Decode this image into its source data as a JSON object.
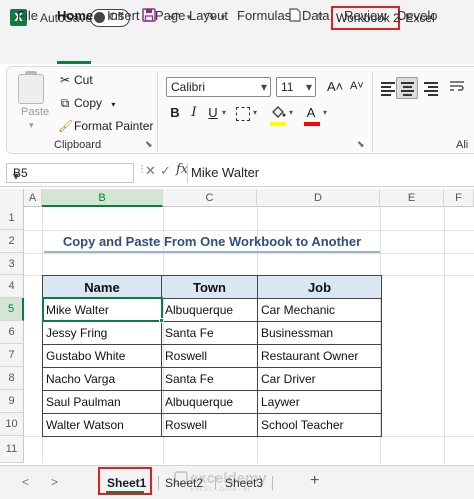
{
  "titlebar": {
    "app_logo": "X",
    "autosave_label": "AutoSave",
    "autosave_state": "Off",
    "document_title": "Workbook 2",
    "app_name": "-  Excel",
    "icons": [
      "excel-logo-icon",
      "save-icon",
      "undo-icon",
      "redo-icon",
      "new-document-icon",
      "customize-quick-access-icon"
    ]
  },
  "tabs": [
    "File",
    "Home",
    "Insert",
    "Page Layout",
    "Formulas",
    "Data",
    "Review",
    "Develo"
  ],
  "active_tab": "Home",
  "ribbon": {
    "clipboard": {
      "paste_label": "Paste",
      "cut_label": "Cut",
      "copy_label": "Copy",
      "format_painter_label": "Format Painter",
      "group_label": "Clipboard"
    },
    "font": {
      "font_name": "Calibri",
      "font_size": "11",
      "bold": "B",
      "italic": "I",
      "underline": "U",
      "grow": "A˄",
      "shrink": "A˅",
      "font_color_letter": "A",
      "fill_color": "#ffff00",
      "font_color": "#ff0000"
    },
    "alignment": {
      "group_label_partial": "Ali"
    }
  },
  "formula_bar": {
    "name_box": "B5",
    "fx": "fx",
    "value": "Mike Walter"
  },
  "grid": {
    "columns": [
      "A",
      "B",
      "C",
      "D",
      "E",
      "F"
    ],
    "selected_column": "B",
    "rows": [
      "1",
      "2",
      "3",
      "4",
      "5",
      "6",
      "7",
      "8",
      "9",
      "10",
      "11"
    ],
    "selected_row": "5",
    "title": "Copy and Paste From One Workbook to Another",
    "table": {
      "headers": [
        "Name",
        "Town",
        "Job"
      ],
      "rows": [
        [
          "Mike Walter",
          "Albuquerque",
          "Car Mechanic"
        ],
        [
          "Jessy Fring",
          "Santa Fe",
          "Businessman"
        ],
        [
          "Gustabo White",
          "Roswell",
          "Restaurant Owner"
        ],
        [
          "Nacho Varga",
          "Santa Fe",
          "Car Driver"
        ],
        [
          "Saul Paulman",
          "Albuquerque",
          "Laywer"
        ],
        [
          "Walter Watson",
          "Roswell",
          "School Teacher"
        ]
      ]
    }
  },
  "sheets": {
    "tabs": [
      "Sheet1",
      "Sheet2",
      "Sheet3"
    ],
    "active": "Sheet1",
    "add_label": "+",
    "prev_arrow": "<",
    "next_arrow": ">"
  },
  "watermark": {
    "name": "exceldemy",
    "sub": "EXCEL · DATA · BI"
  },
  "colors": {
    "accent": "#107c41",
    "highlight_box": "#e02020",
    "header_fill": "#dae6f3",
    "title_text": "#2f4f7f"
  }
}
